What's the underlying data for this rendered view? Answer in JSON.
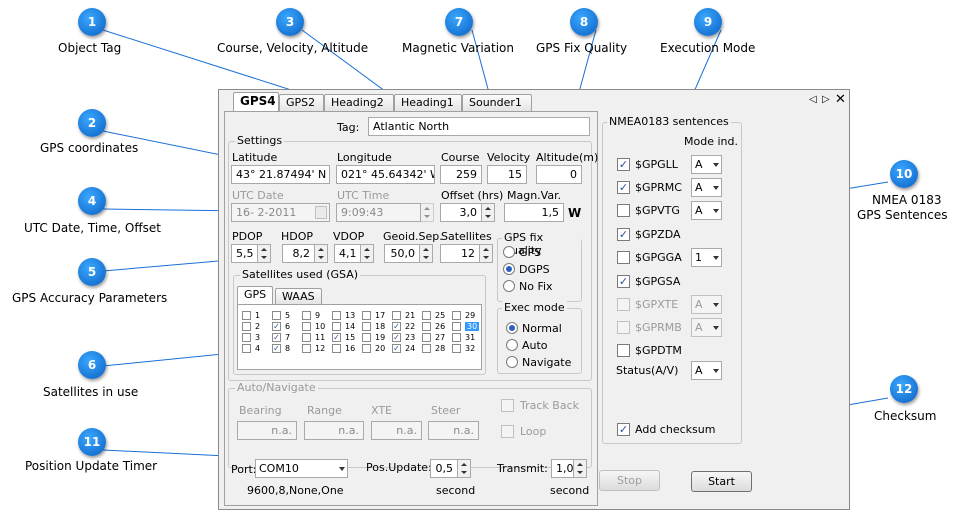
{
  "callouts": [
    {
      "num": "1",
      "label": "Object Tag"
    },
    {
      "num": "2",
      "label": "GPS coordinates"
    },
    {
      "num": "3",
      "label": "Course, Velocity, Altitude"
    },
    {
      "num": "4",
      "label": "UTC Date, Time, Offset"
    },
    {
      "num": "5",
      "label": "GPS Accuracy Parameters"
    },
    {
      "num": "6",
      "label": "Satellites in use"
    },
    {
      "num": "7",
      "label": "Magnetic Variation"
    },
    {
      "num": "8",
      "label": "GPS Fix Quality"
    },
    {
      "num": "9",
      "label": "Execution Mode"
    },
    {
      "num": "10",
      "label": "NMEA 0183"
    },
    {
      "num": "10b",
      "label": "GPS Sentences"
    },
    {
      "num": "11",
      "label": "Position Update Timer"
    },
    {
      "num": "12",
      "label": "Checksum"
    }
  ],
  "tabs": [
    "GPS4",
    "GPS2",
    "Heading2",
    "Heading1",
    "Sounder1"
  ],
  "tag": {
    "label": "Tag:",
    "value": "Atlantic North"
  },
  "settings": {
    "title": "Settings",
    "latitude_label": "Latitude",
    "latitude": "43° 21.87494' N",
    "longitude_label": "Longitude",
    "longitude": "021° 45.64342' W",
    "course_label": "Course",
    "course": "259",
    "velocity_label": "Velocity",
    "velocity": "15",
    "altitude_label": "Altitude(m)",
    "altitude": "0",
    "utcdate_label": "UTC Date",
    "utcdate": "16- 2-2011",
    "utctime_label": "UTC Time",
    "utctime": "9:09:43",
    "offset_label": "Offset (hrs)",
    "offset": "3,0",
    "magvar_label": "Magn.Var.",
    "magvar": "1,5",
    "magdir": "W",
    "pdop_label": "PDOP",
    "pdop": "5,5",
    "hdop_label": "HDOP",
    "hdop": "8,2",
    "vdop_label": "VDOP",
    "vdop": "4,1",
    "geoid_label": "Geoid.Sep.",
    "geoid": "50,0",
    "sats_label": "Satellites",
    "sats": "12"
  },
  "fix": {
    "title": "GPS fix quality",
    "options": [
      "GPS",
      "DGPS",
      "No Fix"
    ]
  },
  "exec": {
    "title": "Exec mode",
    "options": [
      "Normal",
      "Auto",
      "Navigate"
    ]
  },
  "gsa": {
    "title": "Satellites used (GSA)",
    "tab1": "GPS",
    "tab2": "WAAS",
    "col1": [
      "1",
      "2",
      "3",
      "4"
    ],
    "col2": [
      "5",
      "6",
      "7",
      "8"
    ],
    "col3": [
      "9",
      "10",
      "11",
      "12"
    ],
    "col4": [
      "13",
      "14",
      "15",
      "16"
    ],
    "col5": [
      "17",
      "18",
      "19",
      "20"
    ],
    "col6": [
      "21",
      "22",
      "23",
      "24"
    ],
    "col7": [
      "25",
      "26",
      "27",
      "28"
    ],
    "col8": [
      "29",
      "30",
      "31",
      "32"
    ]
  },
  "nav": {
    "title": "Auto/Navigate",
    "bearing": "Bearing",
    "range": "Range",
    "xte": "XTE",
    "steer": "Steer",
    "na": "n.a.",
    "trackback": "Track Back",
    "loop": "Loop"
  },
  "bottom": {
    "port_label": "Port:",
    "port": "COM10",
    "port_info": "9600,8,None,One",
    "posupd_label": "Pos.Update:",
    "posupd": "0,5",
    "second": "second",
    "transmit_label": "Transmit:",
    "transmit": "1,0",
    "stop": "Stop",
    "start": "Start"
  },
  "nmea": {
    "title": "NMEA0183 sentences",
    "mode_header": "Mode ind.",
    "rows": [
      {
        "name": "$GPGLL",
        "mode": "A"
      },
      {
        "name": "$GPRMC",
        "mode": "A"
      },
      {
        "name": "$GPVTG",
        "mode": "A"
      },
      {
        "name": "$GPZDA",
        "mode": ""
      },
      {
        "name": "$GPGGA",
        "mode": "1"
      },
      {
        "name": "$GPGSA",
        "mode": ""
      },
      {
        "name": "$GPXTE",
        "mode": "A"
      },
      {
        "name": "$GPRMB",
        "mode": "A"
      },
      {
        "name": "$GPDTM",
        "mode": ""
      }
    ],
    "status_label": "Status(A/V)",
    "status": "A",
    "checksum": "Add checksum"
  }
}
